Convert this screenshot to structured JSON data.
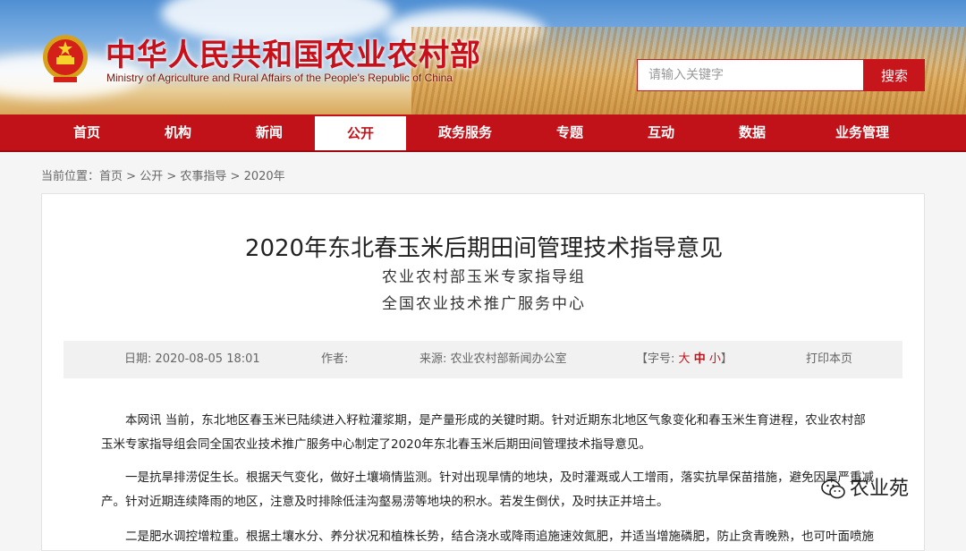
{
  "header": {
    "site_title": "中华人民共和国农业农村部",
    "site_subtitle": "Ministry of Agriculture and Rural Affairs of the People's Republic of China",
    "search_placeholder": "请输入关键字",
    "search_button": "搜索"
  },
  "nav": {
    "items": [
      {
        "label": "首页"
      },
      {
        "label": "机构"
      },
      {
        "label": "新闻"
      },
      {
        "label": "公开"
      },
      {
        "label": "政务服务"
      },
      {
        "label": "专题"
      },
      {
        "label": "互动"
      },
      {
        "label": "数据"
      },
      {
        "label": "业务管理"
      }
    ],
    "active": "公开"
  },
  "breadcrumb": {
    "prefix": "当前位置：",
    "items": [
      "首页",
      "公开",
      "农事指导",
      "2020年"
    ],
    "separator": " > "
  },
  "article": {
    "title": "2020年东北春玉米后期田间管理技术指导意见",
    "authors": [
      "农业农村部玉米专家指导组",
      "全国农业技术推广服务中心"
    ],
    "meta": {
      "date_label": "日期:",
      "date": "2020-08-05 18:01",
      "author_label": "作者:",
      "source_label": "来源:",
      "source": "农业农村部新闻办公室",
      "font_size_label": "【字号:",
      "font_sizes": [
        "大",
        "中",
        "小"
      ],
      "font_size_close": "】",
      "print": "打印本页"
    },
    "paragraphs": [
      "本网讯  当前，东北地区春玉米已陆续进入籽粒灌浆期，是产量形成的关键时期。针对近期东北地区气象变化和春玉米生育进程，农业农村部玉米专家指导组会同全国农业技术推广服务中心制定了2020年东北春玉米后期田间管理技术指导意见。",
      "一是抗旱排涝促生长。根据天气变化，做好土壤墒情监测。针对出现旱情的地块，及时灌溉或人工增雨，落实抗旱保苗措施，避免因旱严重减产。针对近期连续降雨的地区，注意及时排除低洼沟壑易涝等地块的积水。若发生倒伏，及时扶正并培土。",
      "二是肥水调控增粒重。根据土壤水分、养分状况和植株长势，结合浇水或降雨追施速效氮肥，并适当增施磷肥，防止贪青晚熟，也可叶面喷施"
    ]
  },
  "watermark": {
    "text": "农业苑"
  },
  "colors": {
    "brand_red": "#c1121a",
    "meta_bg": "#f1f1f1"
  }
}
